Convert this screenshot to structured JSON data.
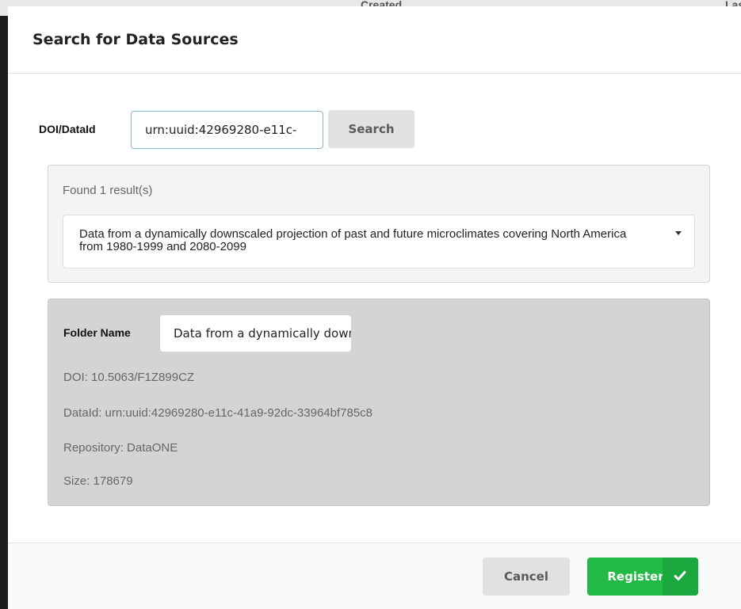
{
  "background": {
    "table_headers": [
      "Created",
      "Last"
    ]
  },
  "modal": {
    "title": "Search for Data Sources",
    "search": {
      "label": "DOI/DataId",
      "value": "urn:uuid:42969280-e11c-",
      "button": "Search"
    },
    "results": {
      "found_text": "Found 1 result(s)",
      "selected": "Data from a dynamically downscaled projection of past and future microclimates covering North America from 1980-1999 and 2080-2099"
    },
    "details": {
      "folder_label": "Folder Name",
      "folder_value": "Data from a dynamically downscaled projection of past and future microclimates covering North America from 1980-1999 and 2080-2099",
      "doi": "DOI: 10.5063/F1Z899CZ",
      "dataid": "DataId: urn:uuid:42969280-e11c-41a9-92dc-33964bf785c8",
      "repository": "Repository: DataONE",
      "size": "Size: 178679"
    },
    "footer": {
      "cancel": "Cancel",
      "register": "Register"
    }
  },
  "colors": {
    "register_green": "#21ba45",
    "input_focus_border": "#85b7d9",
    "details_bg": "#d4d4d4"
  },
  "icons": [
    "caret-down-icon",
    "checkmark-icon"
  ]
}
